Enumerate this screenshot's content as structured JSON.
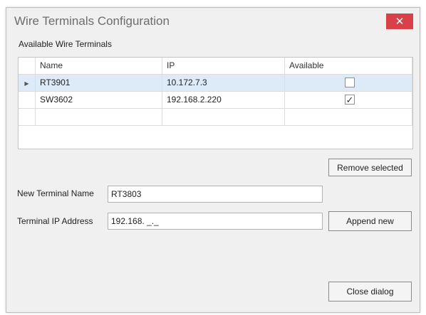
{
  "window": {
    "title": "Wire Terminals Configuration",
    "close_glyph": "✕"
  },
  "group": {
    "label": "Available Wire Terminals"
  },
  "grid": {
    "columns": [
      "Name",
      "IP",
      "Available"
    ],
    "rows": [
      {
        "name": "RT3901",
        "ip": "10.172.7.3",
        "available": false,
        "selected": true,
        "indicator": "▶"
      },
      {
        "name": "SW3602",
        "ip": "192.168.2.220",
        "available": true,
        "selected": false,
        "indicator": ""
      }
    ],
    "check_glyph": "✓"
  },
  "buttons": {
    "remove_selected": "Remove selected",
    "append_new": "Append new",
    "close_dialog": "Close dialog"
  },
  "form": {
    "name_label": "New Terminal Name",
    "name_value": "RT3803",
    "ip_label": "Terminal IP Address",
    "ip_value": "192.168. _._"
  },
  "colors": {
    "close_button": "#d9414a",
    "selected_row": "#ddebf8"
  }
}
